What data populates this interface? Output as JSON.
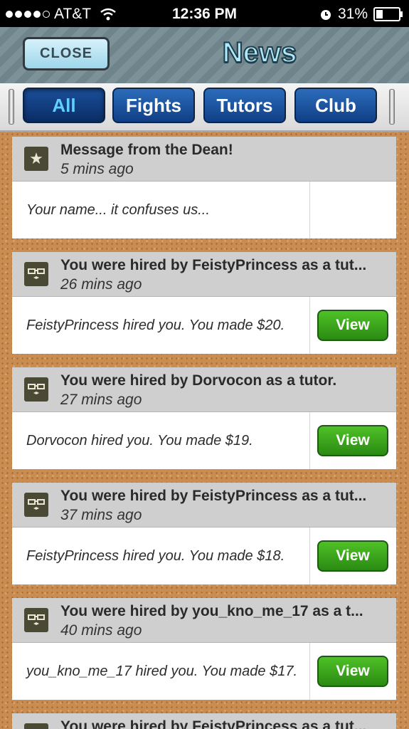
{
  "status_bar": {
    "carrier": "AT&T",
    "time": "12:36 PM",
    "battery": "31%"
  },
  "header": {
    "close_label": "CLOSE",
    "title": "News"
  },
  "tabs": [
    {
      "label": "All",
      "active": true
    },
    {
      "label": "Fights",
      "active": false
    },
    {
      "label": "Tutors",
      "active": false
    },
    {
      "label": "Club",
      "active": false
    }
  ],
  "view_label": "View",
  "news": [
    {
      "icon": "star-icon",
      "title": "Message from the Dean!",
      "time": "5 mins ago",
      "message": "Your name... it confuses us...",
      "has_view": false
    },
    {
      "icon": "tutor-icon",
      "title": "You were hired by FeistyPrincess as a tut...",
      "time": "26 mins ago",
      "message": "FeistyPrincess hired you. You made $20.",
      "has_view": true
    },
    {
      "icon": "tutor-icon",
      "title": "You were hired by Dorvocon as a tutor.",
      "time": "27 mins ago",
      "message": "Dorvocon hired you. You made $19.",
      "has_view": true
    },
    {
      "icon": "tutor-icon",
      "title": "You were hired by FeistyPrincess as a tut...",
      "time": "37 mins ago",
      "message": "FeistyPrincess hired you. You made $18.",
      "has_view": true
    },
    {
      "icon": "tutor-icon",
      "title": "You were hired by you_kno_me_17 as a t...",
      "time": "40 mins ago",
      "message": "you_kno_me_17 hired you. You made $17.",
      "has_view": true
    },
    {
      "icon": "tutor-icon",
      "title": "You were hired by FeistyPrincess as a tut...",
      "time": "",
      "message": "",
      "has_view": true
    }
  ]
}
